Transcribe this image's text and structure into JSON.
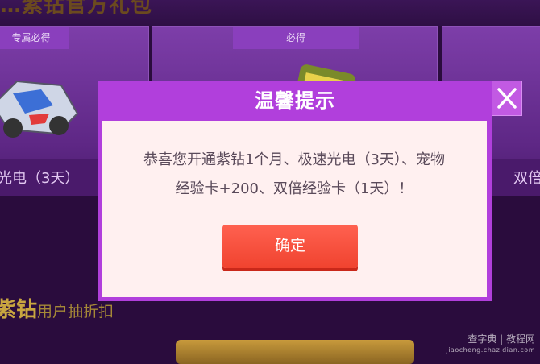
{
  "background": {
    "header_title": "…紫钻官方礼包",
    "cards": [
      {
        "tag": "专属必得",
        "label": "光电（3天）"
      },
      {
        "tag": "必得",
        "label": ""
      },
      {
        "tag": "",
        "label": "双倍"
      }
    ],
    "promo": {
      "highlight": "紫钻",
      "rest": "用户抽折扣"
    }
  },
  "modal": {
    "title": "温馨提示",
    "message_line1": "恭喜您开通紫钻1个月、极速光电（3天）、宠物",
    "message_line2": "经验卡+200、双倍经验卡（1天）！",
    "confirm_label": "确定",
    "close_icon": "close-icon"
  },
  "watermark": {
    "text": "查字典 | 教程网",
    "sub": "jiaocheng.chazidian.com"
  },
  "colors": {
    "modal_frame": "#b13fdc",
    "modal_body": "#fff0f0",
    "confirm": "#f0432f",
    "page_bg": "#2a0c3d"
  }
}
